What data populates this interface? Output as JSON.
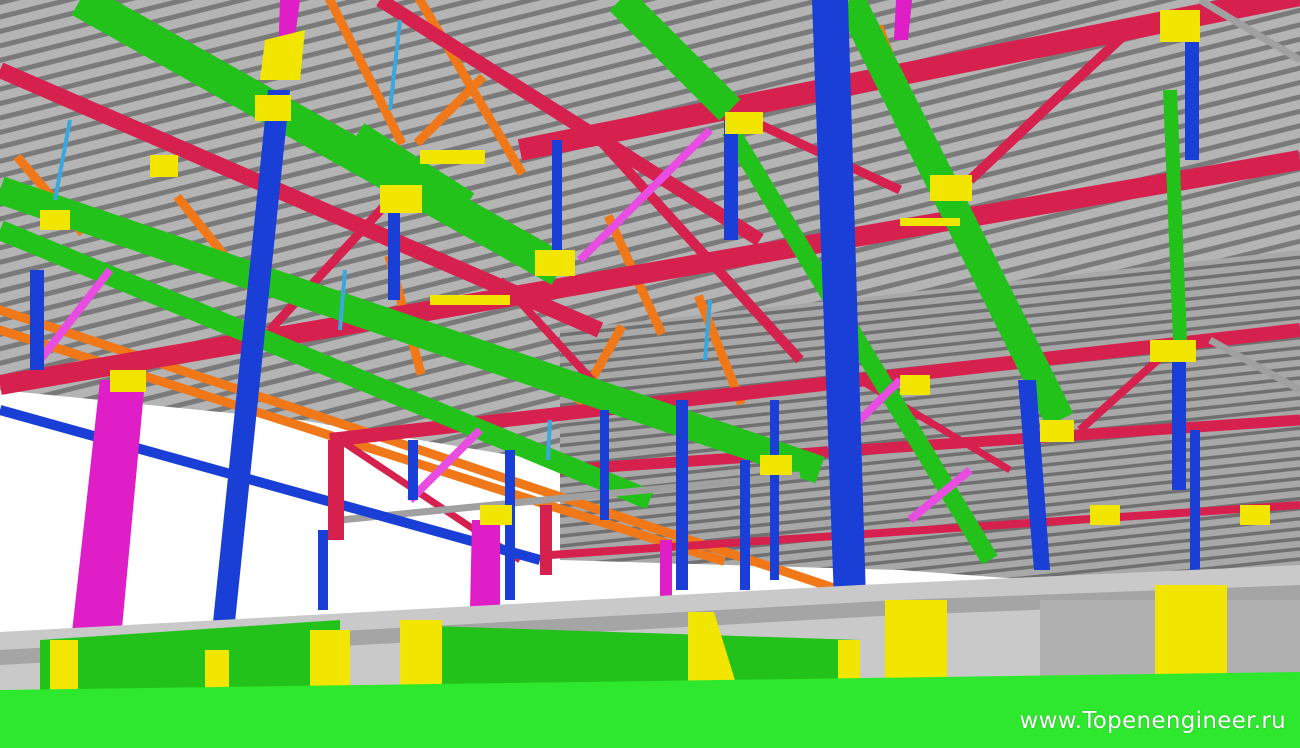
{
  "watermark": {
    "text": "www.Topenengineer.ru"
  },
  "colors": {
    "roof_deck": "#9a9a9a",
    "beam_red": "#d6214f",
    "beam_green": "#22c21a",
    "column_blue": "#1a3fd6",
    "column_magenta": "#e01ec8",
    "truss_orange": "#f07818",
    "connection_plate": "#f2e600",
    "floor_slab": "#c8c8c8",
    "floor_edge_green": "#2ee82e",
    "background": "#ffffff"
  }
}
